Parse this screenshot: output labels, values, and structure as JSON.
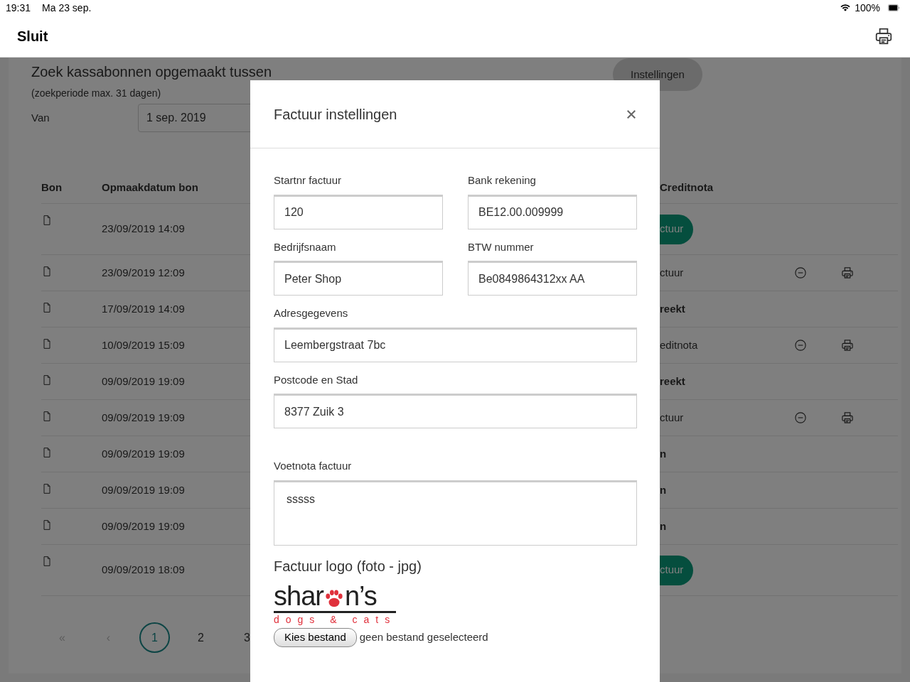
{
  "status_bar": {
    "time": "19:31",
    "date": "Ma 23 sep.",
    "battery": "100%"
  },
  "navbar": {
    "close": "Sluit"
  },
  "search": {
    "title": "Zoek kassabonnen opgemaakt tussen",
    "hint": "(zoekperiode max. 31 dagen)",
    "from_label": "Van",
    "from_value": "1 sep. 2019",
    "settings_button": "Instellingen"
  },
  "table": {
    "columns": [
      "Bon",
      "Opmaakdatum bon",
      "Creditnota"
    ],
    "rows": [
      {
        "date": "23/09/2019 14:09",
        "creditnota": "ctuur",
        "kind": "button",
        "actions": false
      },
      {
        "date": "23/09/2019 12:09",
        "creditnota": "ctuur",
        "kind": "text",
        "actions": true
      },
      {
        "date": "17/09/2019 14:09",
        "creditnota": "reekt",
        "kind": "bold",
        "actions": false
      },
      {
        "date": "10/09/2019 15:09",
        "creditnota": "editnota",
        "kind": "text",
        "actions": true
      },
      {
        "date": "09/09/2019 19:09",
        "creditnota": "reekt",
        "kind": "bold",
        "actions": false
      },
      {
        "date": "09/09/2019 19:09",
        "creditnota": "ctuur",
        "kind": "text",
        "actions": true
      },
      {
        "date": "09/09/2019 19:09",
        "creditnota": "n",
        "kind": "bold",
        "actions": false
      },
      {
        "date": "09/09/2019 19:09",
        "creditnota": "n",
        "kind": "bold",
        "actions": false
      },
      {
        "date": "09/09/2019 19:09",
        "creditnota": "n",
        "kind": "bold",
        "actions": false
      },
      {
        "date": "09/09/2019 18:09",
        "creditnota": "ctuur",
        "kind": "button",
        "actions": false
      }
    ]
  },
  "pagination": [
    {
      "label": "«",
      "selected": false,
      "disabled": true
    },
    {
      "label": "‹",
      "selected": false,
      "disabled": true
    },
    {
      "label": "1",
      "selected": true,
      "disabled": false
    },
    {
      "label": "2",
      "selected": false,
      "disabled": false
    },
    {
      "label": "3",
      "selected": false,
      "disabled": false
    }
  ],
  "modal": {
    "title": "Factuur instellingen",
    "fields": [
      {
        "label": "Startnr factuur",
        "value": "120",
        "kind": "half"
      },
      {
        "label": "Bank rekening",
        "value": "BE12.00.009999",
        "kind": "half"
      },
      {
        "label": "Bedrijfsnaam",
        "value": "Peter Shop",
        "kind": "half"
      },
      {
        "label": "BTW nummer",
        "value": "Be0849864312xx AA",
        "kind": "half"
      },
      {
        "label": "Adresgegevens",
        "value": "Leembergstraat 7bc",
        "kind": "full"
      },
      {
        "label": "Postcode en Stad",
        "value": "8377 Zuik 3",
        "kind": "full"
      },
      {
        "label": "Voetnota factuur",
        "value": "sssss",
        "kind": "textarea"
      }
    ],
    "logo_label": "Factuur logo (foto - jpg)",
    "logo": {
      "name_start": "shar",
      "name_end": "n’s",
      "tagline": "dogs & cats"
    },
    "file_button": "Kies bestand",
    "file_status": "geen bestand geselecteerd"
  }
}
